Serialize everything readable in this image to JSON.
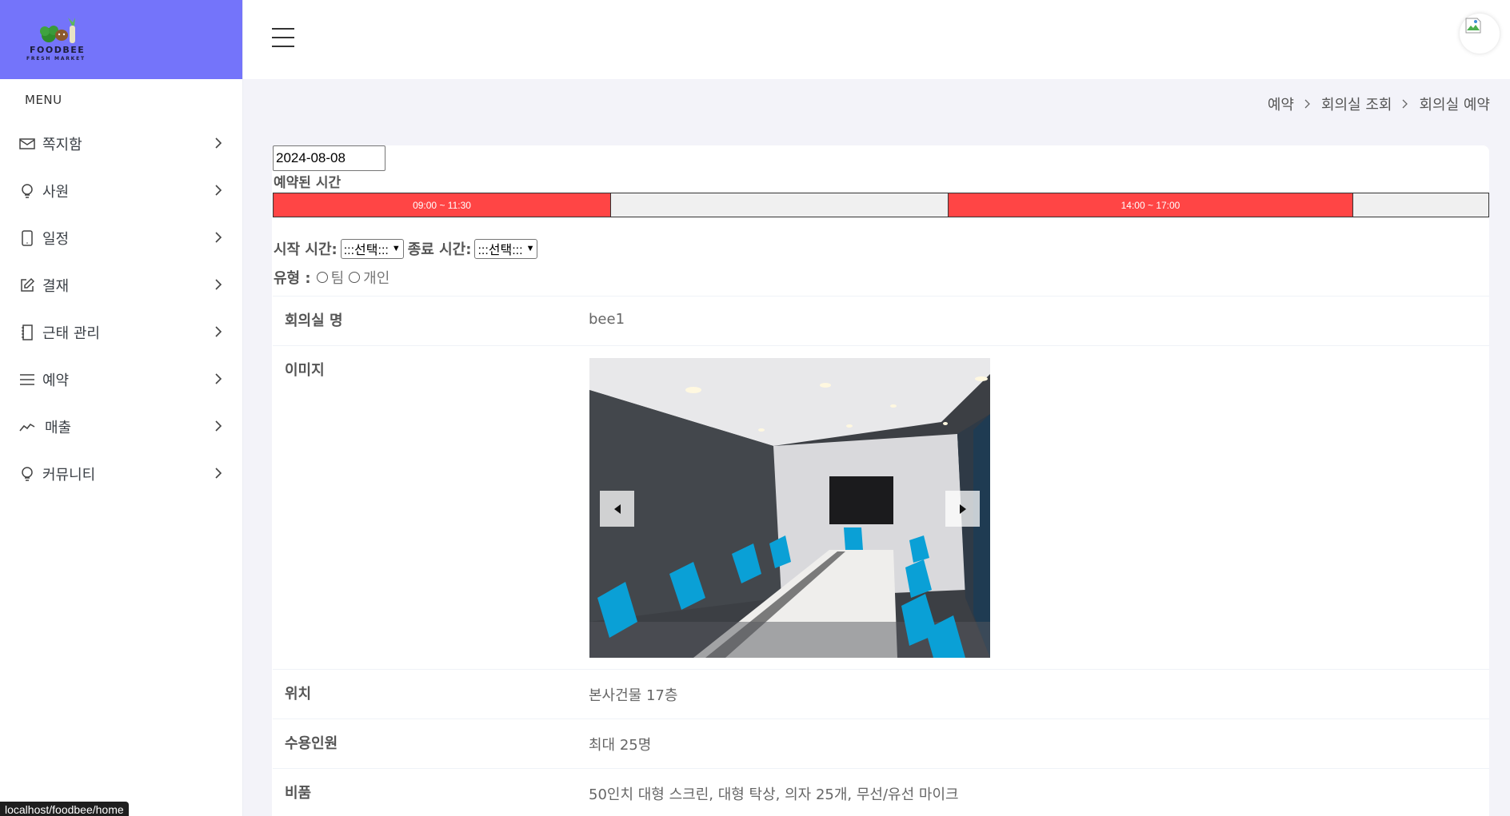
{
  "brand": {
    "name": "FOODBEE",
    "tagline": "FRESH MARKET",
    "color": "#7474fa"
  },
  "sidebar": {
    "menu_title": "MENU",
    "items": [
      {
        "label": "쪽지함",
        "icon": "mail-icon"
      },
      {
        "label": "사원",
        "icon": "lightbulb-icon"
      },
      {
        "label": "일정",
        "icon": "tablet-icon"
      },
      {
        "label": "결재",
        "icon": "edit-icon"
      },
      {
        "label": "근태 관리",
        "icon": "notebook-icon"
      },
      {
        "label": "예약",
        "icon": "list-icon"
      },
      {
        "label": "매출",
        "icon": "trend-icon"
      },
      {
        "label": "커뮤니티",
        "icon": "lightbulb-icon"
      }
    ]
  },
  "breadcrumb": [
    "예약",
    "회의실 조회",
    "회의실 예약"
  ],
  "reservation": {
    "date": "2024-08-08",
    "reserved_label": "예약된 시간",
    "slots": [
      {
        "label": "09:00 ~ 11:30",
        "status": "booked"
      },
      {
        "label": "",
        "status": "free"
      },
      {
        "label": "14:00 ~ 17:00",
        "status": "booked"
      },
      {
        "label": "",
        "status": "free"
      }
    ],
    "booked_color": "#ff4545",
    "start_label": "시작 시간:",
    "start_value": ":::선택:::",
    "end_label": "종료 시간:",
    "end_value": ":::선택:::",
    "type_label": "유형 :",
    "type_options": [
      "팀",
      "개인"
    ]
  },
  "room": {
    "name_label": "회의실 명",
    "name": "bee1",
    "image_label": "이미지",
    "location_label": "위치",
    "location": "본사건물 17층",
    "capacity_label": "수용인원",
    "capacity": "최대 25명",
    "equipment_label": "비품",
    "equipment": "50인치 대형 스크린, 대형 탁상, 의자 25개, 무선/유선 마이크"
  },
  "status_bar": "localhost/foodbee/home"
}
